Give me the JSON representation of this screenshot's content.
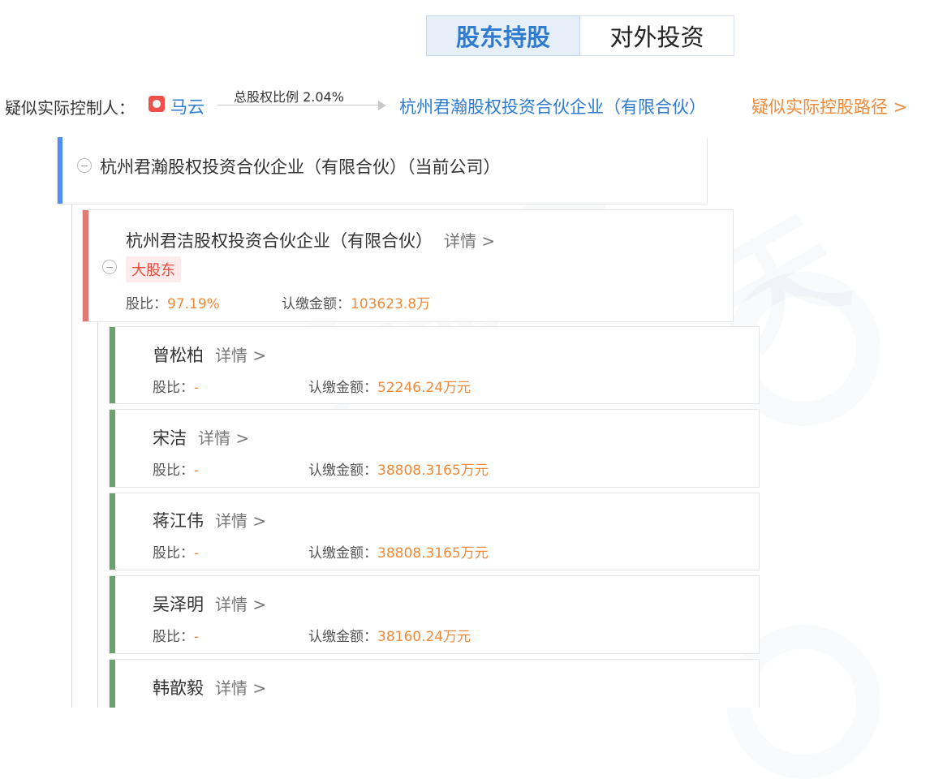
{
  "tabs": [
    {
      "label": "股东持股",
      "active": true
    },
    {
      "label": "对外投资",
      "active": false
    }
  ],
  "controller": {
    "label": "疑似实际控制人：",
    "person_icon": "person-avatar-icon",
    "person_name": "马云",
    "ratio_label": "总股权比例 2.04%",
    "target_company": "杭州君瀚股权投资合伙企业（有限合伙）",
    "path_link": "疑似实际控股路径 >"
  },
  "root": {
    "title": "杭州君瀚股权投资合伙企业（有限合伙）（当前公司）"
  },
  "major": {
    "name": "杭州君洁股权投资合伙企业（有限合伙）",
    "detail": "详情 >",
    "badge": "大股东",
    "ratio_label": "股比：",
    "ratio_value": "97.19%",
    "amount_label": "认缴金额：",
    "amount_value": "103623.8万"
  },
  "holders": [
    {
      "name": "曾松柏",
      "detail": "详情 >",
      "ratio_label": "股比：",
      "ratio_value": "-",
      "amount_label": "认缴金额：",
      "amount_value": "52246.24万元"
    },
    {
      "name": "宋洁",
      "detail": "详情 >",
      "ratio_label": "股比：",
      "ratio_value": "-",
      "amount_label": "认缴金额：",
      "amount_value": "38808.3165万元"
    },
    {
      "name": "蒋江伟",
      "detail": "详情 >",
      "ratio_label": "股比：",
      "ratio_value": "-",
      "amount_label": "认缴金额：",
      "amount_value": "38808.3165万元"
    },
    {
      "name": "吴泽明",
      "detail": "详情 >",
      "ratio_label": "股比：",
      "ratio_value": "-",
      "amount_label": "认缴金额：",
      "amount_value": "38160.24万元"
    },
    {
      "name": "韩歆毅",
      "detail": "详情 >",
      "ratio_label": "",
      "ratio_value": "",
      "amount_label": "",
      "amount_value": ""
    }
  ],
  "colors": {
    "accent_blue": "#2e7bd1",
    "root_bar": "#4f8ff7",
    "major_bar": "#e07a73",
    "holder_bar": "#6aa36d",
    "value_orange": "#ef8a3a"
  }
}
